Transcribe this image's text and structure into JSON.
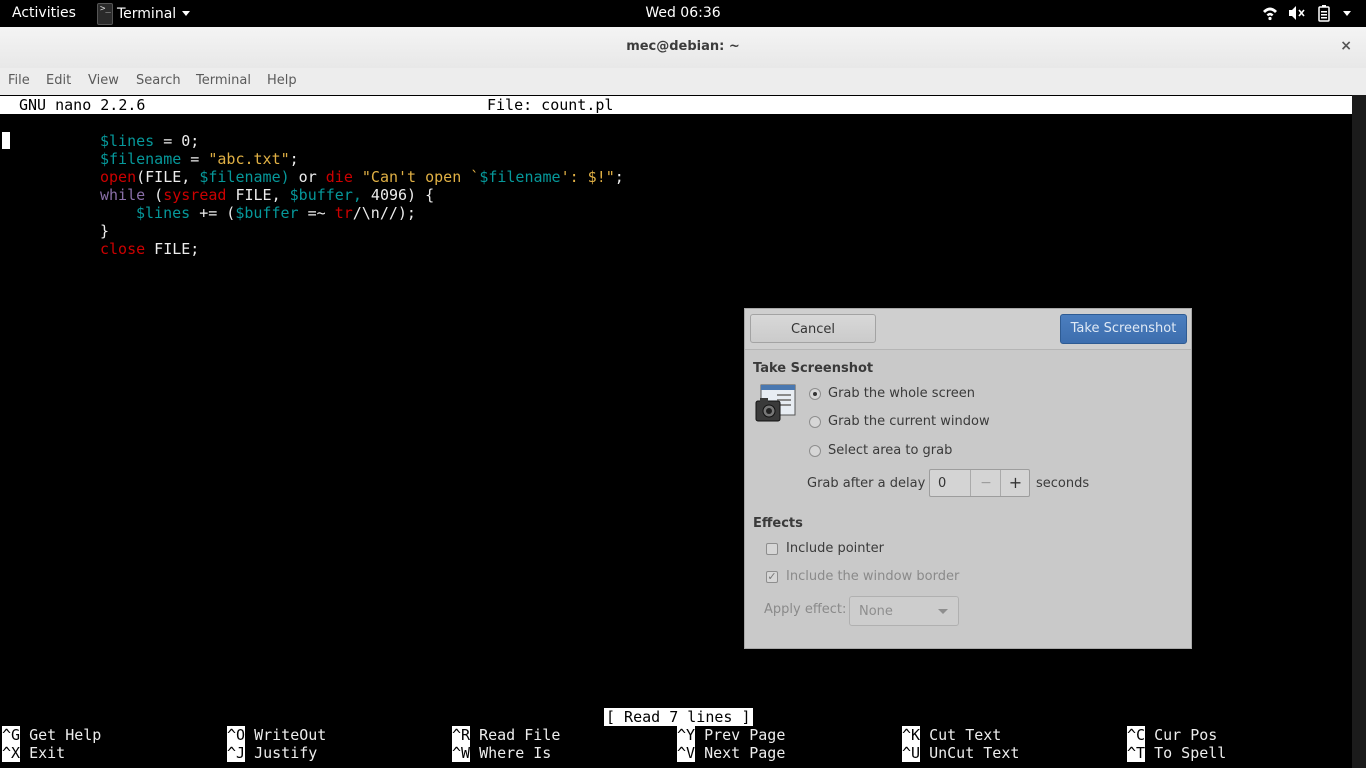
{
  "topbar": {
    "activities": "Activities",
    "app_name": "Terminal",
    "app_icon_glyph": ">_",
    "clock": "Wed 06:36",
    "tray_icons": [
      "wifi-icon",
      "volume-muted-icon",
      "battery-icon",
      "system-menu-arrow-icon"
    ]
  },
  "window": {
    "title": "mec@debian: ~",
    "close_glyph": "×",
    "menu": [
      "File",
      "Edit",
      "View",
      "Search",
      "Terminal",
      "Help"
    ]
  },
  "nano": {
    "version": "GNU nano 2.2.6",
    "file": "File: count.pl",
    "status": "[ Read 7 lines ]",
    "shortcuts": [
      {
        "key": "^G",
        "label": "Get Help"
      },
      {
        "key": "^O",
        "label": "WriteOut"
      },
      {
        "key": "^R",
        "label": "Read File"
      },
      {
        "key": "^Y",
        "label": "Prev Page"
      },
      {
        "key": "^K",
        "label": "Cut Text"
      },
      {
        "key": "^C",
        "label": "Cur Pos"
      },
      {
        "key": "^X",
        "label": "Exit"
      },
      {
        "key": "^J",
        "label": "Justify"
      },
      {
        "key": "^W",
        "label": "Where Is"
      },
      {
        "key": "^V",
        "label": "Next Page"
      },
      {
        "key": "^U",
        "label": "UnCut Text"
      },
      {
        "key": "^T",
        "label": "To Spell"
      }
    ],
    "code_tokens": {
      "l1": [
        "$lines",
        " = 0;"
      ],
      "l2": [
        "$filename",
        " = ",
        "\"abc.txt\"",
        ";"
      ],
      "l3": [
        "open",
        "(FILE, ",
        "$filename)",
        " or ",
        "die",
        " ",
        "\"Can't open `",
        "$filename",
        "': $!\"",
        ";"
      ],
      "l4": [
        "while",
        " (",
        "sysread",
        " FILE, ",
        "$buffer,",
        " 4096) {"
      ],
      "l5": [
        "$lines",
        " += (",
        "$buffer",
        " =~ ",
        "tr",
        "/\\n//);"
      ],
      "l6": [
        "}"
      ],
      "l7": [
        "close",
        " FILE;"
      ]
    }
  },
  "dialog": {
    "cancel": "Cancel",
    "take": "Take Screenshot",
    "section_take": "Take Screenshot",
    "options": [
      "Grab the whole screen",
      "Grab the current window",
      "Select area to grab"
    ],
    "selected_option": "Grab the whole screen",
    "delay_label": "Grab after a delay of",
    "delay_value": "0",
    "delay_minus": "−",
    "delay_plus": "+",
    "delay_unit": "seconds",
    "section_effects": "Effects",
    "include_pointer": "Include pointer",
    "include_pointer_checked": false,
    "include_border": "Include the window border",
    "include_border_checked": true,
    "apply_effect_label": "Apply effect:",
    "apply_effect_value": "None"
  }
}
